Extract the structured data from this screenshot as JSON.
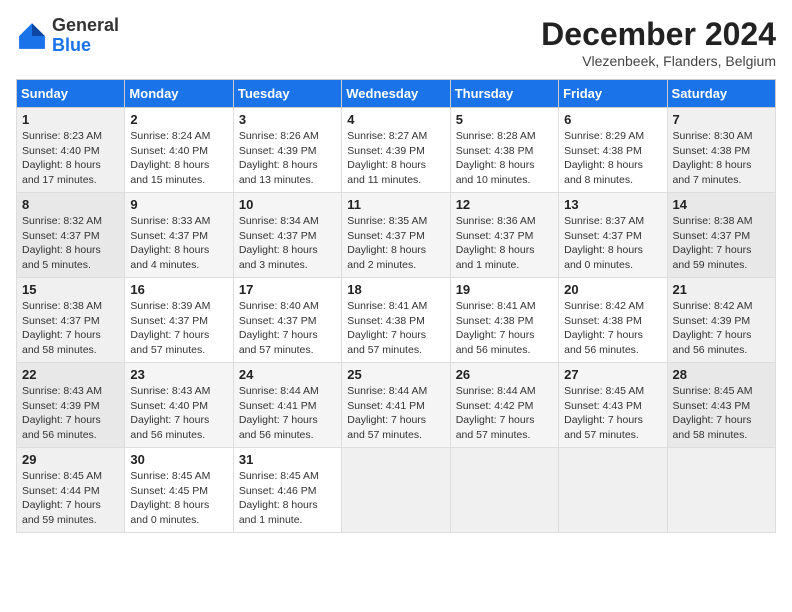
{
  "header": {
    "logo_general": "General",
    "logo_blue": "Blue",
    "month_title": "December 2024",
    "subtitle": "Vlezenbeek, Flanders, Belgium"
  },
  "days_of_week": [
    "Sunday",
    "Monday",
    "Tuesday",
    "Wednesday",
    "Thursday",
    "Friday",
    "Saturday"
  ],
  "weeks": [
    [
      {
        "day": "1",
        "sunrise": "8:23 AM",
        "sunset": "4:40 PM",
        "daylight": "8 hours and 17 minutes."
      },
      {
        "day": "2",
        "sunrise": "8:24 AM",
        "sunset": "4:40 PM",
        "daylight": "8 hours and 15 minutes."
      },
      {
        "day": "3",
        "sunrise": "8:26 AM",
        "sunset": "4:39 PM",
        "daylight": "8 hours and 13 minutes."
      },
      {
        "day": "4",
        "sunrise": "8:27 AM",
        "sunset": "4:39 PM",
        "daylight": "8 hours and 11 minutes."
      },
      {
        "day": "5",
        "sunrise": "8:28 AM",
        "sunset": "4:38 PM",
        "daylight": "8 hours and 10 minutes."
      },
      {
        "day": "6",
        "sunrise": "8:29 AM",
        "sunset": "4:38 PM",
        "daylight": "8 hours and 8 minutes."
      },
      {
        "day": "7",
        "sunrise": "8:30 AM",
        "sunset": "4:38 PM",
        "daylight": "8 hours and 7 minutes."
      }
    ],
    [
      {
        "day": "8",
        "sunrise": "8:32 AM",
        "sunset": "4:37 PM",
        "daylight": "8 hours and 5 minutes."
      },
      {
        "day": "9",
        "sunrise": "8:33 AM",
        "sunset": "4:37 PM",
        "daylight": "8 hours and 4 minutes."
      },
      {
        "day": "10",
        "sunrise": "8:34 AM",
        "sunset": "4:37 PM",
        "daylight": "8 hours and 3 minutes."
      },
      {
        "day": "11",
        "sunrise": "8:35 AM",
        "sunset": "4:37 PM",
        "daylight": "8 hours and 2 minutes."
      },
      {
        "day": "12",
        "sunrise": "8:36 AM",
        "sunset": "4:37 PM",
        "daylight": "8 hours and 1 minute."
      },
      {
        "day": "13",
        "sunrise": "8:37 AM",
        "sunset": "4:37 PM",
        "daylight": "8 hours and 0 minutes."
      },
      {
        "day": "14",
        "sunrise": "8:38 AM",
        "sunset": "4:37 PM",
        "daylight": "7 hours and 59 minutes."
      }
    ],
    [
      {
        "day": "15",
        "sunrise": "8:38 AM",
        "sunset": "4:37 PM",
        "daylight": "7 hours and 58 minutes."
      },
      {
        "day": "16",
        "sunrise": "8:39 AM",
        "sunset": "4:37 PM",
        "daylight": "7 hours and 57 minutes."
      },
      {
        "day": "17",
        "sunrise": "8:40 AM",
        "sunset": "4:37 PM",
        "daylight": "7 hours and 57 minutes."
      },
      {
        "day": "18",
        "sunrise": "8:41 AM",
        "sunset": "4:38 PM",
        "daylight": "7 hours and 57 minutes."
      },
      {
        "day": "19",
        "sunrise": "8:41 AM",
        "sunset": "4:38 PM",
        "daylight": "7 hours and 56 minutes."
      },
      {
        "day": "20",
        "sunrise": "8:42 AM",
        "sunset": "4:38 PM",
        "daylight": "7 hours and 56 minutes."
      },
      {
        "day": "21",
        "sunrise": "8:42 AM",
        "sunset": "4:39 PM",
        "daylight": "7 hours and 56 minutes."
      }
    ],
    [
      {
        "day": "22",
        "sunrise": "8:43 AM",
        "sunset": "4:39 PM",
        "daylight": "7 hours and 56 minutes."
      },
      {
        "day": "23",
        "sunrise": "8:43 AM",
        "sunset": "4:40 PM",
        "daylight": "7 hours and 56 minutes."
      },
      {
        "day": "24",
        "sunrise": "8:44 AM",
        "sunset": "4:41 PM",
        "daylight": "7 hours and 56 minutes."
      },
      {
        "day": "25",
        "sunrise": "8:44 AM",
        "sunset": "4:41 PM",
        "daylight": "7 hours and 57 minutes."
      },
      {
        "day": "26",
        "sunrise": "8:44 AM",
        "sunset": "4:42 PM",
        "daylight": "7 hours and 57 minutes."
      },
      {
        "day": "27",
        "sunrise": "8:45 AM",
        "sunset": "4:43 PM",
        "daylight": "7 hours and 57 minutes."
      },
      {
        "day": "28",
        "sunrise": "8:45 AM",
        "sunset": "4:43 PM",
        "daylight": "7 hours and 58 minutes."
      }
    ],
    [
      {
        "day": "29",
        "sunrise": "8:45 AM",
        "sunset": "4:44 PM",
        "daylight": "7 hours and 59 minutes."
      },
      {
        "day": "30",
        "sunrise": "8:45 AM",
        "sunset": "4:45 PM",
        "daylight": "8 hours and 0 minutes."
      },
      {
        "day": "31",
        "sunrise": "8:45 AM",
        "sunset": "4:46 PM",
        "daylight": "8 hours and 1 minute."
      },
      null,
      null,
      null,
      null
    ]
  ]
}
